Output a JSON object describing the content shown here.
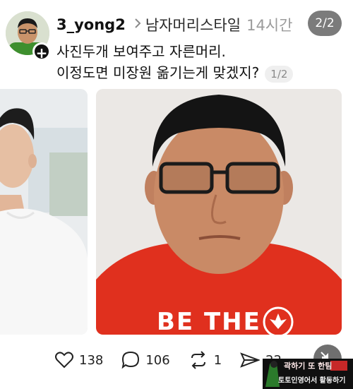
{
  "post": {
    "username": "3_yong2",
    "community": "남자머리스타일",
    "time": "14시간",
    "page_indicator": "2/2",
    "follow_symbol": "+",
    "text_line1": "사진두개 보여주고 자른머리.",
    "text_line2": "이정도면 미장원 옮기는게 맞겠지?",
    "image_counter": "1/2"
  },
  "images": {
    "shirt_text": "BE THE"
  },
  "actions": {
    "likes": "138",
    "comments": "106",
    "reposts": "1",
    "shares": "22"
  },
  "watermark": {
    "line1": "곽하기 또 한팀",
    "line2": "토토인영어서 활동하기"
  },
  "icons": {
    "like": "heart-icon",
    "comment": "speech-bubble-icon",
    "repost": "repost-icon",
    "share": "send-icon",
    "mute": "speaker-muted-icon",
    "follow": "plus-icon",
    "chevron": "chevron-right-icon"
  },
  "colors": {
    "pill_bg": "#7b7b7b",
    "shirt_red": "#e0301e",
    "secondary_text": "#9b9b9b"
  }
}
